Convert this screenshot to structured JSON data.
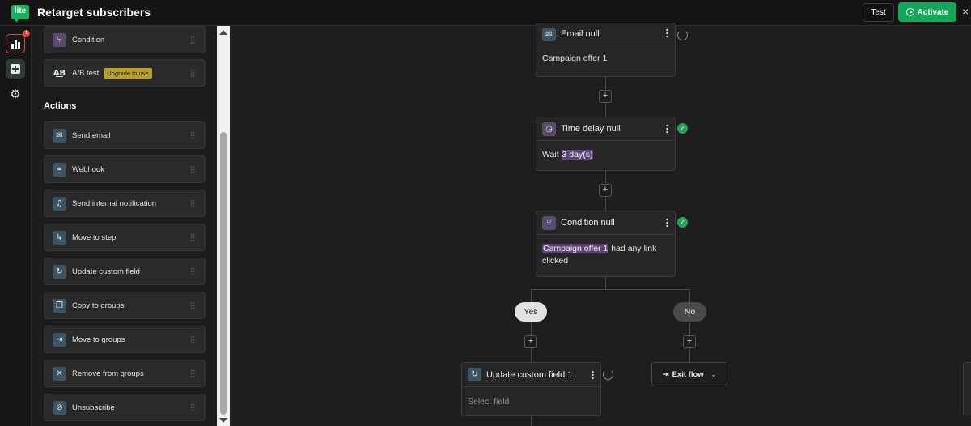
{
  "app": {
    "title": "Retarget subscribers",
    "logo": "lite"
  },
  "toolbar": {
    "test_label": "Test",
    "activate_label": "Activate",
    "close_label": "×"
  },
  "rail": {
    "badge_count": "1"
  },
  "panel": {
    "top_items": [
      {
        "label": "Condition",
        "icon": "condition-icon"
      },
      {
        "label": "A/B test",
        "icon": "ab-test-icon",
        "badge": "Upgrade to use"
      }
    ],
    "actions_title": "Actions",
    "actions": [
      {
        "label": "Send email",
        "icon": "email-icon"
      },
      {
        "label": "Webhook",
        "icon": "webhook-icon"
      },
      {
        "label": "Send internal notification",
        "icon": "bell-icon"
      },
      {
        "label": "Move to step",
        "icon": "move-step-icon"
      },
      {
        "label": "Update custom field",
        "icon": "refresh-icon"
      },
      {
        "label": "Copy to groups",
        "icon": "copy-icon"
      },
      {
        "label": "Move to groups",
        "icon": "move-groups-icon"
      },
      {
        "label": "Remove from groups",
        "icon": "remove-icon"
      },
      {
        "label": "Unsubscribe",
        "icon": "unsubscribe-icon"
      }
    ]
  },
  "flow": {
    "email_node": {
      "title": "Email null",
      "body": "Campaign offer 1",
      "status": "pending"
    },
    "delay_node": {
      "title": "Time delay null",
      "body_prefix": "Wait",
      "body_value": "3 day(s)",
      "status": "ok"
    },
    "condition_node": {
      "title": "Condition null",
      "body_highlight": "Campaign offer 1",
      "body_rest": "had any link clicked",
      "status": "ok"
    },
    "branch_yes": "Yes",
    "branch_no": "No",
    "update_node": {
      "title": "Update custom field 1",
      "placeholder": "Select field",
      "status": "pending"
    },
    "exit_label": "Exit flow",
    "add_label": "+"
  },
  "colors": {
    "accent": "#11a85a",
    "highlight": "#5d4677",
    "success": "#22a35a"
  }
}
